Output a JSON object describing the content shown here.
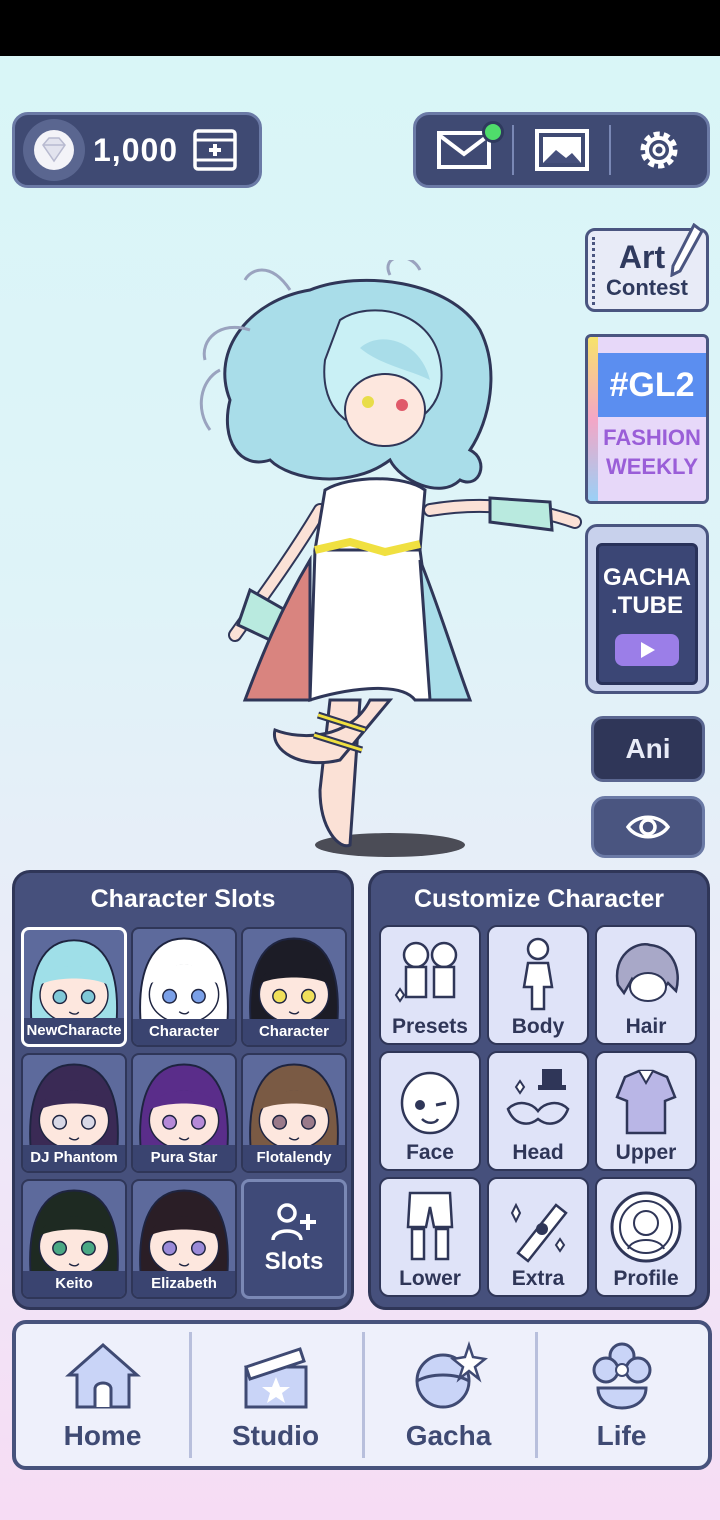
{
  "currency": {
    "gems": "1,000",
    "icon": "gem-icon",
    "action_icon": "video-add-icon"
  },
  "top_right": {
    "buttons": [
      "mail-icon",
      "gallery-icon",
      "settings-icon"
    ],
    "mail_has_notification": true
  },
  "side_buttons": {
    "art_contest": {
      "line1": "Art",
      "line2": "Contest"
    },
    "gl2": {
      "title": "#GL2",
      "line1": "FASHION",
      "line2": "WEEKLY"
    },
    "gacha_tube": {
      "line1": "GACHA",
      "line2": ".TUBE"
    },
    "ani": "Ani",
    "visibility_icon": "eye-icon"
  },
  "character_slots": {
    "title": "Character Slots",
    "slots": [
      {
        "label": "NewCharacte",
        "hair": "#9fdfe8",
        "skin": "#fde7de",
        "eyes": "#7fc8d8",
        "selected": true
      },
      {
        "label": "Character",
        "hair": "#ffffff",
        "skin": "#ffffff",
        "eyes": "#7aa0e8",
        "selected": false
      },
      {
        "label": "Character",
        "hair": "#1c1c26",
        "skin": "#fde7de",
        "eyes": "#f0e05a",
        "selected": false
      },
      {
        "label": "DJ Phantom",
        "hair": "#3a2a55",
        "skin": "#fde7de",
        "eyes": "#d8d8e6",
        "selected": false
      },
      {
        "label": "Pura Star",
        "hair": "#5a2d8a",
        "skin": "#fde7de",
        "eyes": "#b58ad8",
        "selected": false
      },
      {
        "label": "Flotalendy",
        "hair": "#7a5a44",
        "skin": "#fde7de",
        "eyes": "#9a7a8a",
        "selected": false
      },
      {
        "label": "Keito",
        "hair": "#1e2a22",
        "skin": "#fde7de",
        "eyes": "#4aa884",
        "selected": false
      },
      {
        "label": "Elizabeth",
        "hair": "#2a1e26",
        "skin": "#fde7de",
        "eyes": "#9a8ad8",
        "selected": false
      }
    ],
    "add_label": "Slots"
  },
  "customize": {
    "title": "Customize Character",
    "items": [
      {
        "label": "Presets",
        "icon": "presets-icon"
      },
      {
        "label": "Body",
        "icon": "body-icon"
      },
      {
        "label": "Hair",
        "icon": "hair-icon"
      },
      {
        "label": "Face",
        "icon": "face-icon"
      },
      {
        "label": "Head",
        "icon": "head-icon"
      },
      {
        "label": "Upper",
        "icon": "upper-icon"
      },
      {
        "label": "Lower",
        "icon": "lower-icon"
      },
      {
        "label": "Extra",
        "icon": "extra-icon"
      },
      {
        "label": "Profile",
        "icon": "profile-icon"
      }
    ]
  },
  "nav": [
    {
      "label": "Home",
      "icon": "home-icon"
    },
    {
      "label": "Studio",
      "icon": "studio-icon"
    },
    {
      "label": "Gacha",
      "icon": "gacha-icon"
    },
    {
      "label": "Life",
      "icon": "life-icon"
    }
  ],
  "colors": {
    "panel": "#46507c",
    "accent": "#5b8ef0",
    "notification": "#4fdc6b"
  }
}
